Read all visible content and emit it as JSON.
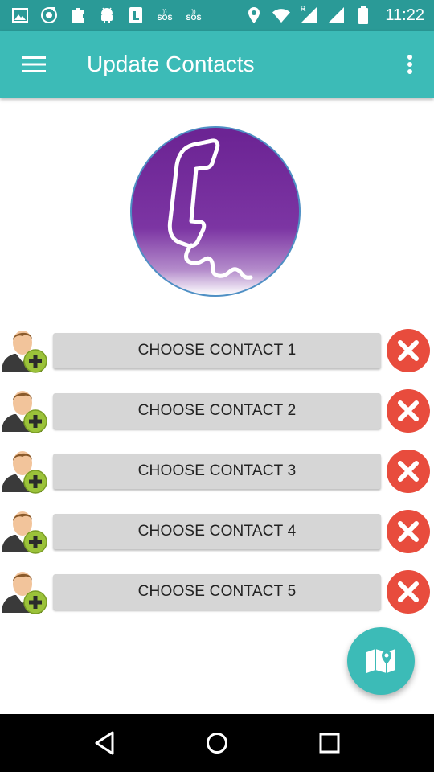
{
  "status_bar": {
    "time": "11:22",
    "sos_labels": [
      "SOS",
      "SOS"
    ],
    "left_icons": [
      "image-icon",
      "music-icon",
      "puzzle-icon",
      "android-icon",
      "sim-icon",
      "sos-icon",
      "sos-icon"
    ],
    "right_icons": [
      "location-icon",
      "wifi-icon",
      "signal-roaming-icon",
      "signal-icon",
      "battery-icon"
    ],
    "roaming_label": "R"
  },
  "app_bar": {
    "title": "Update Contacts",
    "menu_icon": "hamburger-menu-icon",
    "overflow_icon": "more-vert-icon"
  },
  "logo": {
    "icon": "phone-handset-icon",
    "colors": [
      "#7a2a9a",
      "#5e1f80",
      "#ffffff"
    ]
  },
  "contacts": [
    {
      "label": "CHOOSE CONTACT 1"
    },
    {
      "label": "CHOOSE CONTACT 2"
    },
    {
      "label": "CHOOSE CONTACT 3"
    },
    {
      "label": "CHOOSE CONTACT 4"
    },
    {
      "label": "CHOOSE CONTACT 5"
    }
  ],
  "fab": {
    "icon": "map-icon"
  },
  "nav_bar": {
    "icons": [
      "back-icon",
      "home-icon",
      "recents-icon"
    ]
  },
  "colors": {
    "primary": "#3cbbb7",
    "primary_dark": "#2a9a97",
    "remove": "#e84c3d",
    "button": "#d6d6d6"
  }
}
